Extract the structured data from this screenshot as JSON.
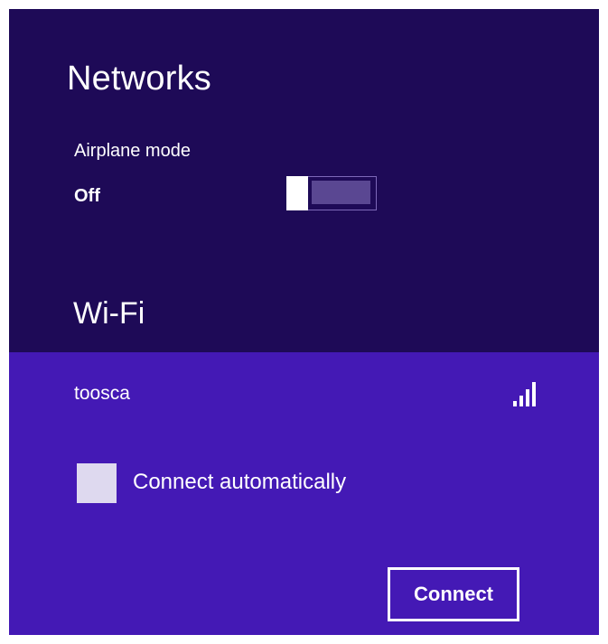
{
  "networks_panel": {
    "title": "Networks",
    "airplane_mode": {
      "label": "Airplane mode",
      "state": "Off",
      "enabled": false
    },
    "wifi": {
      "header": "Wi-Fi",
      "network": {
        "name": "toosca",
        "signal_icon": "wifi-signal-icon",
        "signal_bars": 4
      },
      "connect_automatically": {
        "label": "Connect automatically",
        "checked": false
      },
      "connect_button_label": "Connect"
    }
  },
  "colors": {
    "top_background": "#1e0a57",
    "selected_background": "#4419b5",
    "text": "#ffffff",
    "checkbox_fill": "#ded9ef"
  }
}
